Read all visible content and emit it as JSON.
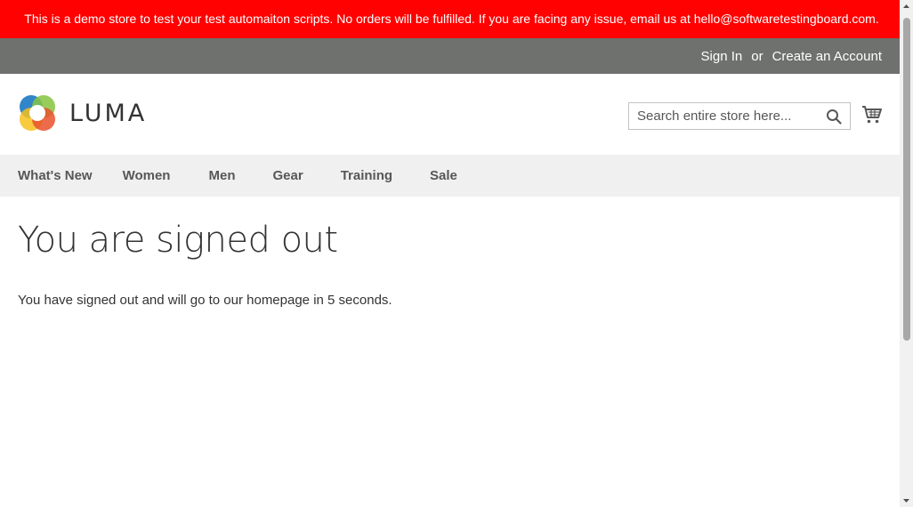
{
  "demo_notice": "This is a demo store to test your test automaiton scripts. No orders will be fulfilled. If you are facing any issue, email us at hello@softwaretestingboard.com.",
  "header_panel": {
    "sign_in": "Sign In",
    "separator": "or",
    "create_account": "Create an Account"
  },
  "logo": {
    "text": "LUMA",
    "colors": [
      "#1979c3",
      "#86c440",
      "#f7c11d",
      "#e9512b"
    ]
  },
  "search": {
    "placeholder": "Search entire store here...",
    "value": ""
  },
  "icons": {
    "search": "search-icon",
    "cart": "cart-icon"
  },
  "nav": {
    "items": [
      {
        "label": "What's New"
      },
      {
        "label": "Women"
      },
      {
        "label": "Men"
      },
      {
        "label": "Gear"
      },
      {
        "label": "Training"
      },
      {
        "label": "Sale"
      }
    ]
  },
  "main": {
    "title": "You are signed out",
    "message": "You have signed out and will go to our homepage in 5 seconds."
  },
  "colors": {
    "notice_bg": "#ff0101",
    "panel_bg": "#6e716e",
    "nav_bg": "#f0f0f0",
    "text": "#333333"
  }
}
